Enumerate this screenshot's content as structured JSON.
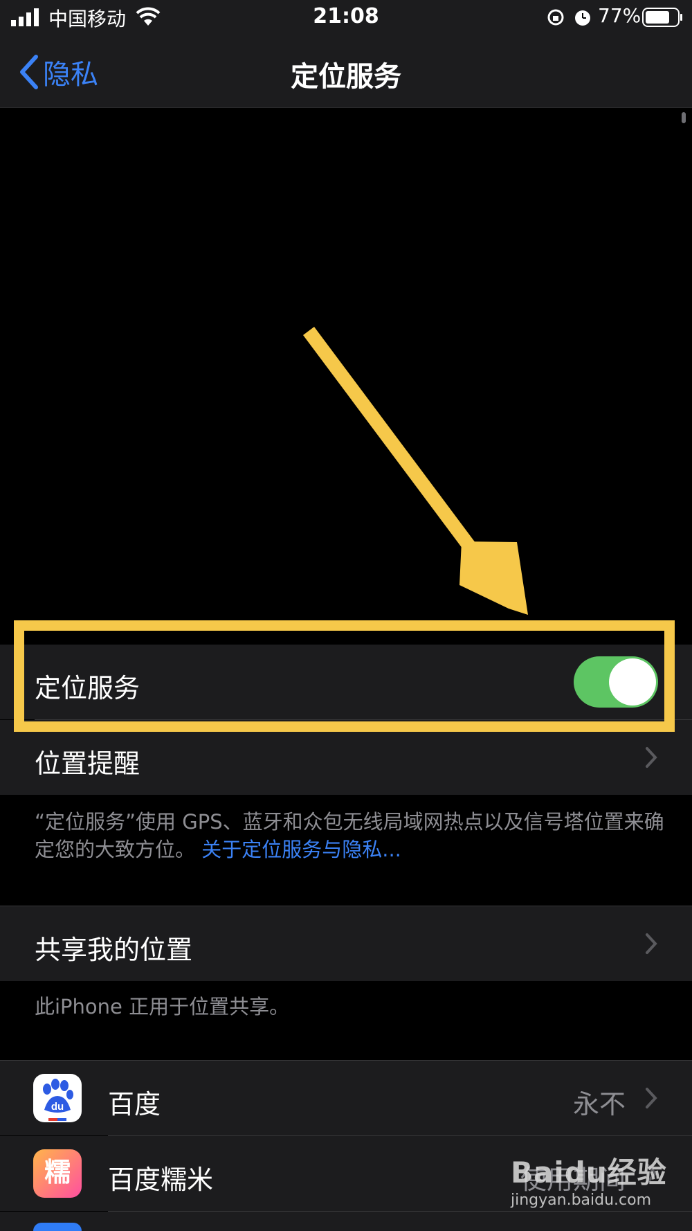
{
  "status_bar": {
    "carrier": "中国移动",
    "time": "21:08",
    "battery_percent": "77%",
    "battery_level": 0.77,
    "signal_icon": "signal-bars-icon",
    "wifi_icon": "wifi-icon",
    "rotation_lock_icon": "rotation-lock-icon",
    "alarm_icon": "alarm-icon",
    "battery_icon": "battery-icon"
  },
  "nav": {
    "back_label": "隐私",
    "title": "定位服务"
  },
  "location_services": {
    "label": "定位服务",
    "enabled": true
  },
  "location_alerts": {
    "label": "位置提醒"
  },
  "footer_note": {
    "text": "“定位服务”使用 GPS、蓝牙和众包无线局域网热点以及信号塔位置来确定您的大致方位。",
    "link": "关于定位服务与隐私..."
  },
  "share_location": {
    "label": "共享我的位置",
    "note": "此iPhone 正用于位置共享。"
  },
  "apps": [
    {
      "name": "百度",
      "value": "永不",
      "icon": "baidu-app-icon"
    },
    {
      "name": "百度糯米",
      "value": "使用期间",
      "icon": "baidu-nuomi-app-icon"
    }
  ],
  "watermark": {
    "text": "Baidu经验",
    "url": "jingyan.baidu.com"
  },
  "colors": {
    "accent_blue": "#3b82f6",
    "toggle_green": "#5dc563",
    "highlight_yellow": "#f6c84a",
    "cell_bg": "#1c1c1e"
  }
}
